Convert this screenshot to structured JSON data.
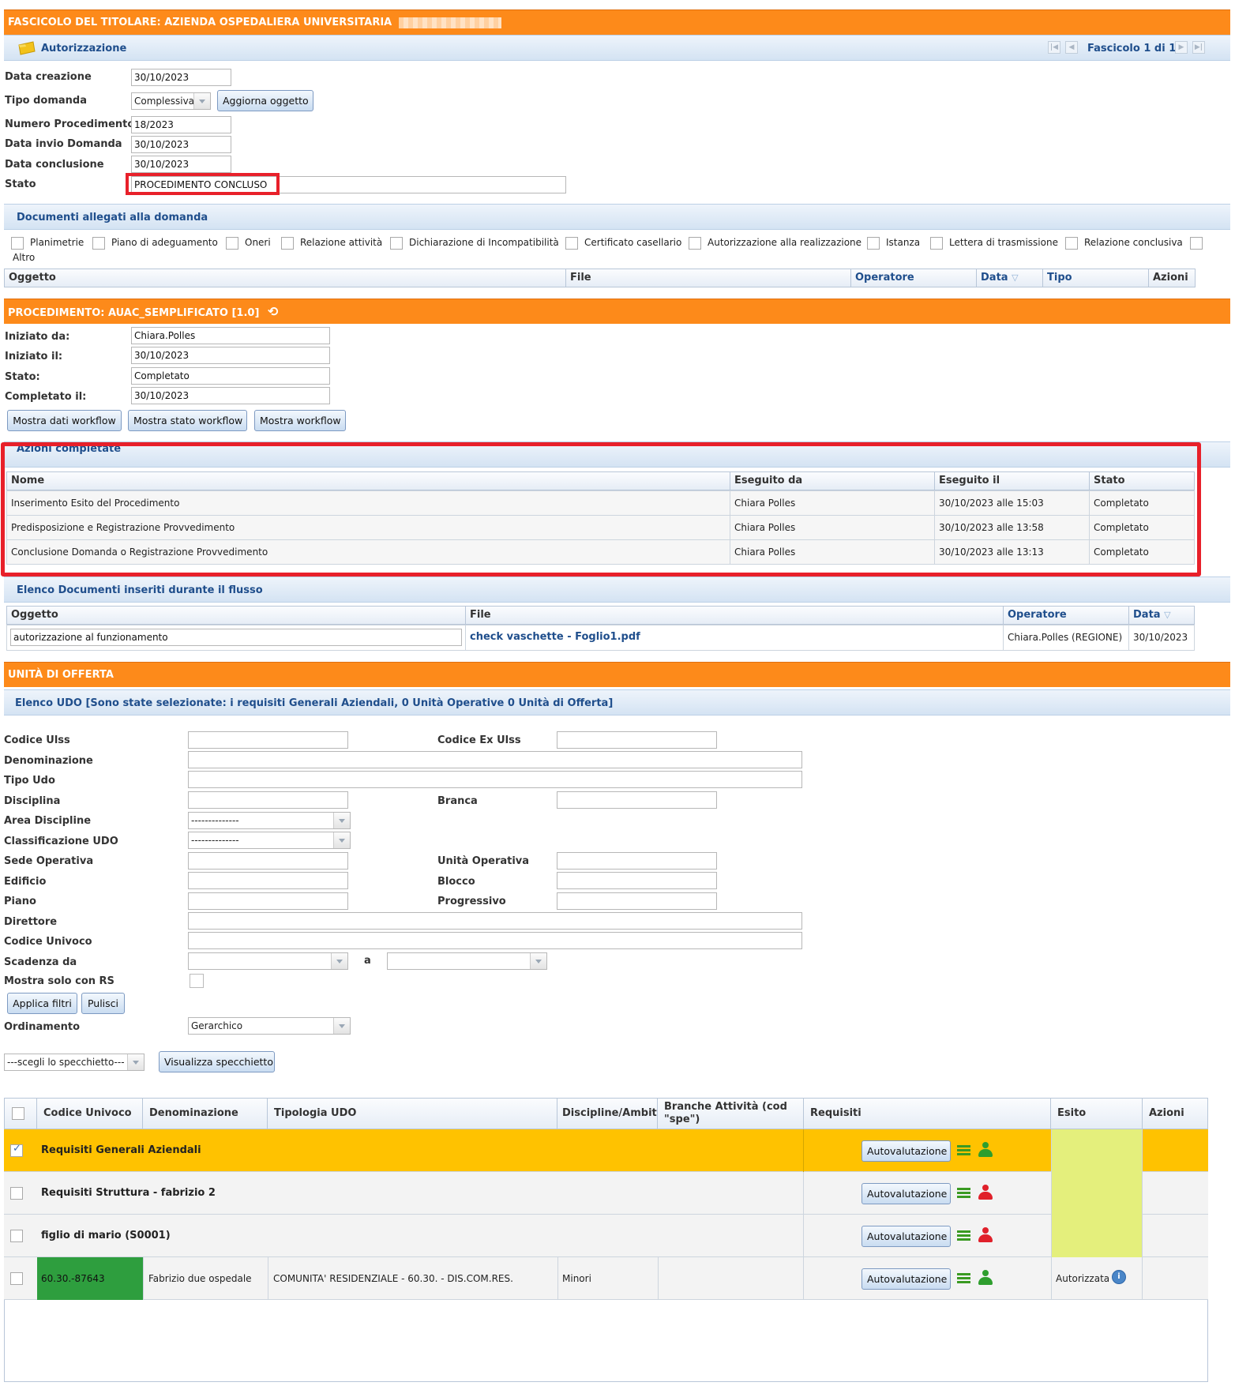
{
  "colors": {
    "orange_bar": "#fd8a1a",
    "highlight_red": "#e8202a",
    "row_selected": "#ffc200",
    "green_code": "#2e9e3e",
    "esito_yellow": "#e4ef7c"
  },
  "fascicolo": {
    "title": "FASCICOLO DEL TITOLARE: AZIENDA OSPEDALIERA UNIVERSITARIA",
    "section": "Autorizzazione",
    "nav_label": "Fascicolo 1 di 1",
    "fields": {
      "data_creazione_label": "Data creazione",
      "data_creazione": "30/10/2023",
      "tipo_domanda_label": "Tipo domanda",
      "tipo_domanda": "Complessiva",
      "aggiorna_label": "Aggiorna oggetto",
      "numero_label": "Numero Procedimento",
      "numero": "18/2023",
      "invio_label": "Data invio Domanda",
      "invio": "30/10/2023",
      "conclusione_label": "Data conclusione",
      "conclusione": "30/10/2023",
      "stato_label": "Stato",
      "stato": "PROCEDIMENTO CONCLUSO"
    }
  },
  "documenti": {
    "title": "Documenti allegati alla domanda",
    "checkboxes": [
      "Planimetrie",
      "Piano di adeguamento",
      "Oneri",
      "Relazione attività",
      "Dichiarazione di Incompatibilità",
      "Certificato casellario",
      "Autorizzazione alla realizzazione",
      "Istanza",
      "Lettera di trasmissione",
      "Relazione conclusiva"
    ],
    "altro": "Altro",
    "columns": [
      "Oggetto",
      "File",
      "Operatore",
      "Data",
      "Tipo",
      "Azioni"
    ]
  },
  "procedimento": {
    "title": "PROCEDIMENTO: AUAC_SEMPLIFICATO [1.0]",
    "iniziato_da_label": "Iniziato da:",
    "iniziato_da": "Chiara.Polles",
    "iniziato_il_label": "Iniziato il:",
    "iniziato_il": "30/10/2023",
    "stato_label": "Stato:",
    "stato": "Completato",
    "completato_label": "Completato il:",
    "completato": "30/10/2023",
    "buttons": [
      "Mostra dati workflow",
      "Mostra stato workflow",
      "Mostra workflow"
    ]
  },
  "azioni": {
    "title": "Azioni completate",
    "columns": [
      "Nome",
      "Eseguito da",
      "Eseguito il",
      "Stato"
    ],
    "rows": [
      [
        "Inserimento Esito del Procedimento",
        "Chiara Polles",
        "30/10/2023 alle 15:03",
        "Completato"
      ],
      [
        "Predisposizione e Registrazione Provvedimento",
        "Chiara Polles",
        "30/10/2023 alle 13:58",
        "Completato"
      ],
      [
        "Conclusione Domanda o Registrazione Provvedimento",
        "Chiara Polles",
        "30/10/2023 alle 13:13",
        "Completato"
      ]
    ]
  },
  "elenco_doc": {
    "title": "Elenco Documenti inseriti durante il flusso",
    "columns": [
      "Oggetto",
      "File",
      "Operatore",
      "Data"
    ],
    "row": [
      "autorizzazione al funzionamento",
      "check vaschette - Foglio1.pdf",
      "Chiara.Polles (REGIONE)",
      "30/10/2023"
    ]
  },
  "udo": {
    "title": "UNITÀ DI OFFERTA",
    "subtitle": "Elenco UDO [Sono state selezionate: i requisiti Generali Aziendali, 0 Unità Operative 0 Unità di Offerta]",
    "filters": {
      "codice_ulss": "Codice Ulss",
      "codice_ex_ulss": "Codice Ex Ulss",
      "denominazione": "Denominazione",
      "tipo_udo": "Tipo Udo",
      "disciplina": "Disciplina",
      "branca": "Branca",
      "area_discipline": "Area Discipline",
      "area_value": "--------------",
      "classificazione": "Classificazione UDO",
      "class_value": "--------------",
      "sede": "Sede Operativa",
      "unita_operativa": "Unità Operativa",
      "edificio": "Edificio",
      "blocco": "Blocco",
      "piano": "Piano",
      "progressivo": "Progressivo",
      "direttore": "Direttore",
      "codice_univoco": "Codice Univoco",
      "scadenza": "Scadenza da",
      "a": "a",
      "solo_rs": "Mostra solo con RS",
      "applica": "Applica filtri",
      "pulisci": "Pulisci",
      "ordinamento": "Ordinamento",
      "ordinamento_value": "Gerarchico",
      "specchietto": "---scegli lo specchietto---",
      "visualizza": "Visualizza specchietto"
    },
    "columns": [
      "Codice Univoco",
      "Denominazione",
      "Tipologia UDO",
      "Discipline/Ambiti",
      "Branche Attività (cod \"spe\")",
      "Requisiti",
      "Esito",
      "Azioni"
    ],
    "autoval": "Autovalutazione",
    "rows": [
      {
        "title": "Requisiti Generali Aziendali",
        "checked": true,
        "user_color": "#2e9e2e"
      },
      {
        "title": "Requisiti Struttura - fabrizio 2",
        "checked": false,
        "user_color": "#e0202a"
      },
      {
        "title": "figlio di mario (S0001)",
        "checked": false,
        "user_color": "#e0202a"
      }
    ],
    "detail_row": {
      "codice": "60.30.-87643",
      "denominazione": "Fabrizio due ospedale",
      "tipologia": "COMUNITA' RESIDENZIALE - 60.30. - DIS.COM.RES.",
      "discipline": "Minori",
      "branche": "",
      "esito": "Autorizzata",
      "user_color": "#2e9e2e"
    }
  }
}
